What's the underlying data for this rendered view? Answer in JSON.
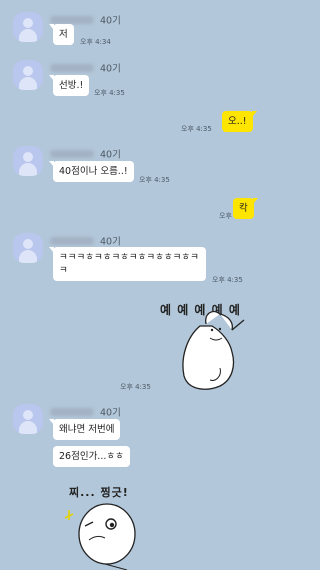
{
  "chat": {
    "sender_generation": "40기",
    "messages": {
      "m1": {
        "text": "저",
        "time": "오후 4:34"
      },
      "m2": {
        "text": "선방.!",
        "time": "오후 4:35"
      },
      "m3": {
        "text": "오..!",
        "time": "오후 4:35"
      },
      "m4": {
        "text": "40점이나 오름..!",
        "time": "오후 4:35"
      },
      "m5": {
        "text": "칵",
        "time": "오후 4:35"
      },
      "m6": {
        "text": "ㅋㅋㅋㅎㅋㅎㅋㅎㅋㅎㅋㅎㅎㅋㅎㅋㅋ",
        "time": "오후 4:35"
      },
      "m7": {
        "sticker_text": "예 예 예 예 예",
        "time": "오후 4:35"
      },
      "m8": {
        "text": "왜냐면 저번에"
      },
      "m9": {
        "text": "26점인가...ㅎㅎ"
      },
      "m10": {
        "sticker_text": "찌... 찡긋!"
      }
    }
  },
  "colors": {
    "background": "#b2c7d9",
    "mine_bubble": "#fee500",
    "other_bubble": "#ffffff",
    "avatar": "#b9c6ee"
  }
}
